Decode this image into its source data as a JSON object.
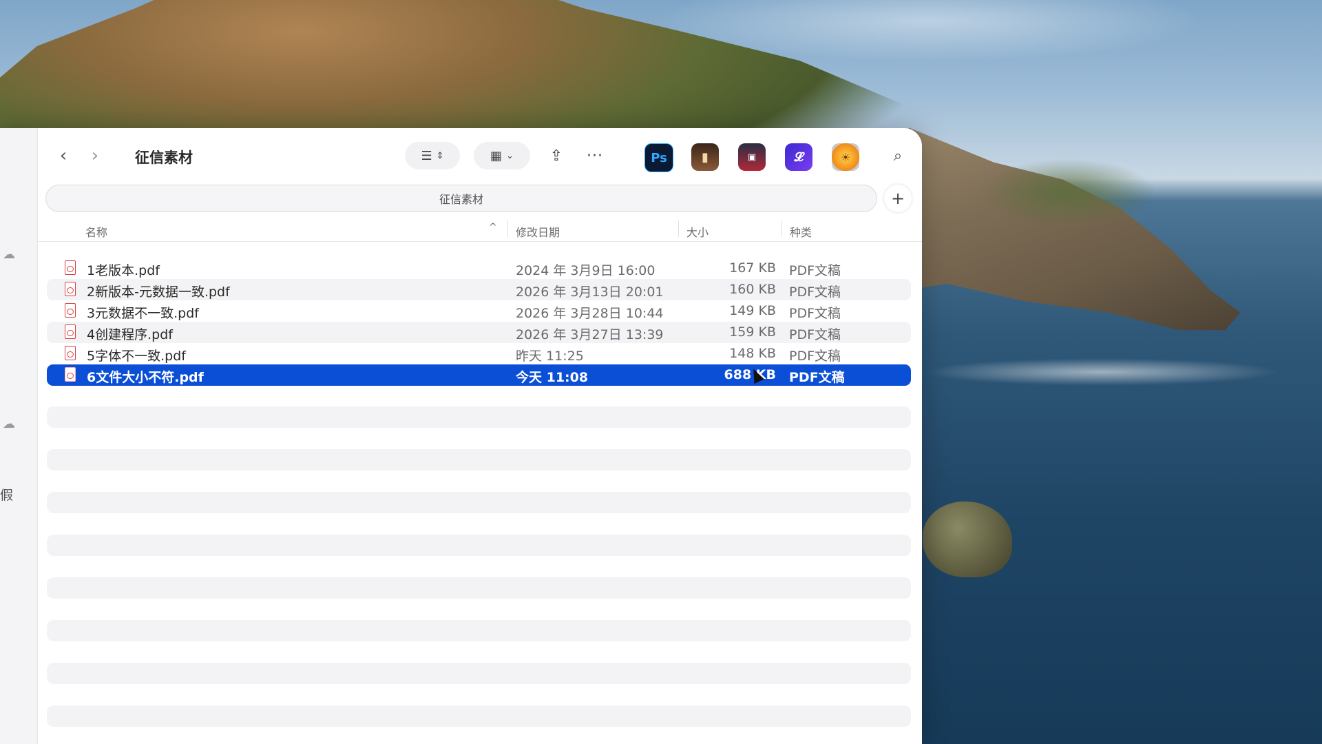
{
  "window": {
    "title": "征信素材",
    "path_label": "征信素材"
  },
  "sidebar": {
    "partial_text": "假"
  },
  "toolbar": {
    "back_icon": "chevron-left-icon",
    "forward_icon": "chevron-right-icon",
    "view_icon": "list-view-icon",
    "group_icon": "grid-group-icon",
    "share_icon": "share-icon",
    "more_icon": "ellipsis-icon",
    "search_icon": "search-icon",
    "apps": [
      {
        "name": "photoshop-app-icon",
        "glyph": "Ps"
      },
      {
        "name": "app-icon-2",
        "glyph": "▮"
      },
      {
        "name": "app-icon-3",
        "glyph": "▣"
      },
      {
        "name": "app-icon-4",
        "glyph": "𝓛"
      },
      {
        "name": "app-icon-5",
        "glyph": "☀"
      }
    ],
    "add_tab": "+"
  },
  "columns": {
    "name": "名称",
    "modified": "修改日期",
    "size": "大小",
    "kind": "种类",
    "sort_indicator": "^"
  },
  "files": [
    {
      "name": "1老版本.pdf",
      "modified": "2024 年 3月9日 16:00",
      "size": "167 KB",
      "kind": "PDF文稿"
    },
    {
      "name": "2新版本-元数据一致.pdf",
      "modified": "2026 年 3月13日 20:01",
      "size": "160 KB",
      "kind": "PDF文稿"
    },
    {
      "name": "3元数据不一致.pdf",
      "modified": "2026 年 3月28日 10:44",
      "size": "149 KB",
      "kind": "PDF文稿"
    },
    {
      "name": "4创建程序.pdf",
      "modified": "2026 年 3月27日 13:39",
      "size": "159 KB",
      "kind": "PDF文稿"
    },
    {
      "name": "5字体不一致.pdf",
      "modified": "昨天 11:25",
      "size": "148 KB",
      "kind": "PDF文稿"
    },
    {
      "name": "6文件大小不符.pdf",
      "modified": "今天 11:08",
      "size": "688 KB",
      "kind": "PDF文稿",
      "selected": true
    }
  ],
  "colors": {
    "selection": "#0a4fd6",
    "pdf_icon": "#d64040"
  }
}
